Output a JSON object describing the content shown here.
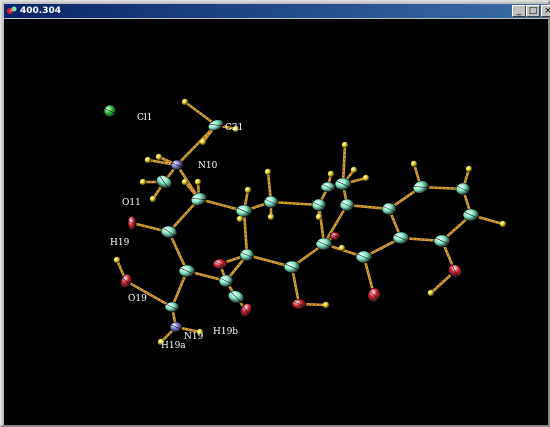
{
  "window": {
    "title": "400.304",
    "icon": "ortep-app-icon",
    "buttons": {
      "minimize": "_",
      "maximize": "□",
      "close": "×"
    }
  },
  "labels": [
    {
      "id": "Cl1",
      "text": "Cl1"
    },
    {
      "id": "C21",
      "text": "C21"
    },
    {
      "id": "N10",
      "text": "N10"
    },
    {
      "id": "O11",
      "text": "O11"
    },
    {
      "id": "H19",
      "text": "H19"
    },
    {
      "id": "O19",
      "text": "O19"
    },
    {
      "id": "N19",
      "text": "N19"
    },
    {
      "id": "H19a",
      "text": "H19a"
    },
    {
      "id": "H19b",
      "text": "H19b"
    }
  ],
  "colors": {
    "background": "#000000",
    "bond": "#d9a53a",
    "carbon": "#7fe8c4",
    "oxygen": "#d42030",
    "nitrogen": "#7b7bd4",
    "hydrogen": "#e8d21c",
    "chlorine": "#2ec23a"
  }
}
